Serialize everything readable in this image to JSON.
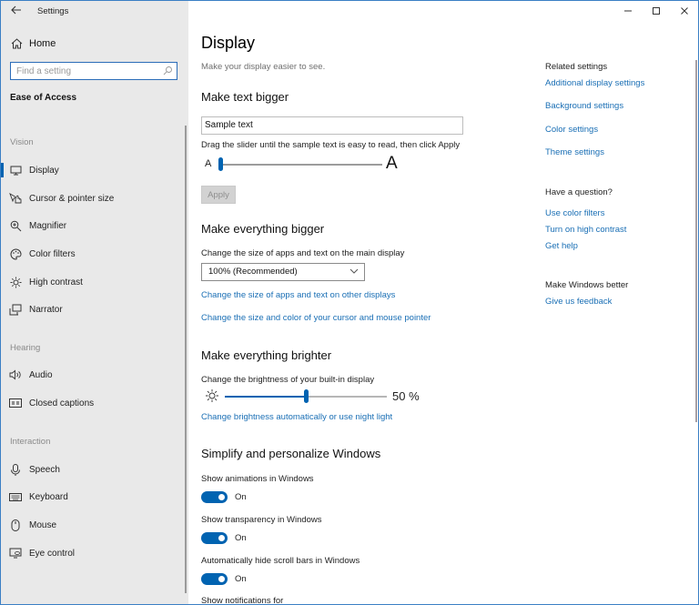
{
  "window": {
    "title": "Settings",
    "caption_buttons": [
      "minimize",
      "maximize",
      "close"
    ]
  },
  "sidebar": {
    "back_icon": "arrow-left-icon",
    "home": {
      "label": "Home",
      "icon": "home-icon"
    },
    "search": {
      "placeholder": "Find a setting",
      "value": "",
      "icon": "search-icon"
    },
    "section_title": "Ease of Access",
    "groups": [
      {
        "label": "Vision",
        "items": [
          {
            "label": "Display",
            "icon": "monitor-icon",
            "active": true
          },
          {
            "label": "Cursor & pointer size",
            "icon": "cursor-hand-icon",
            "active": false
          },
          {
            "label": "Magnifier",
            "icon": "magnifier-icon",
            "active": false
          },
          {
            "label": "Color filters",
            "icon": "palette-icon",
            "active": false
          },
          {
            "label": "High contrast",
            "icon": "sun-icon",
            "active": false
          },
          {
            "label": "Narrator",
            "icon": "narrator-icon",
            "active": false
          }
        ]
      },
      {
        "label": "Hearing",
        "items": [
          {
            "label": "Audio",
            "icon": "speaker-icon",
            "active": false
          },
          {
            "label": "Closed captions",
            "icon": "captions-icon",
            "active": false
          }
        ]
      },
      {
        "label": "Interaction",
        "items": [
          {
            "label": "Speech",
            "icon": "microphone-icon",
            "active": false
          },
          {
            "label": "Keyboard",
            "icon": "keyboard-icon",
            "active": false
          },
          {
            "label": "Mouse",
            "icon": "mouse-icon",
            "active": false
          },
          {
            "label": "Eye control",
            "icon": "eye-control-icon",
            "active": false
          }
        ]
      }
    ]
  },
  "main": {
    "title": "Display",
    "subtitle": "Make your display easier to see.",
    "text_bigger": {
      "heading": "Make text bigger",
      "sample_text": "Sample text",
      "instruction": "Drag the slider until the sample text is easy to read, then click Apply",
      "slider_small_label": "A",
      "slider_large_label": "A",
      "slider_value": 0,
      "apply_label": "Apply"
    },
    "everything_bigger": {
      "heading": "Make everything bigger",
      "label": "Change the size of apps and text on the main display",
      "selected": "100% (Recommended)",
      "link1": "Change the size of apps and text on other displays",
      "link2": "Change the size and color of your cursor and mouse pointer"
    },
    "brighter": {
      "heading": "Make everything brighter",
      "label": "Change the brightness of your built-in display",
      "value_percent": 50,
      "value_text": "50 %",
      "link": "Change brightness automatically or use night light"
    },
    "simplify": {
      "heading": "Simplify and personalize Windows",
      "toggles": [
        {
          "label": "Show animations in Windows",
          "state": "On",
          "on": true
        },
        {
          "label": "Show transparency in Windows",
          "state": "On",
          "on": true
        },
        {
          "label": "Automatically hide scroll bars in Windows",
          "state": "On",
          "on": true
        }
      ],
      "next_label": "Show notifications for"
    }
  },
  "related": {
    "heading": "Related settings",
    "links": [
      "Additional display settings",
      "Background settings",
      "Color settings",
      "Theme settings"
    ],
    "question_heading": "Have a question?",
    "question_links": [
      "Use color filters",
      "Turn on high contrast",
      "Get help"
    ],
    "better_heading": "Make Windows better",
    "better_link": "Give us feedback"
  },
  "colors": {
    "accent": "#0063b1",
    "link": "#1a6fb5",
    "sidebar_bg": "#e9e9e9",
    "window_border": "#3b7fc4"
  }
}
